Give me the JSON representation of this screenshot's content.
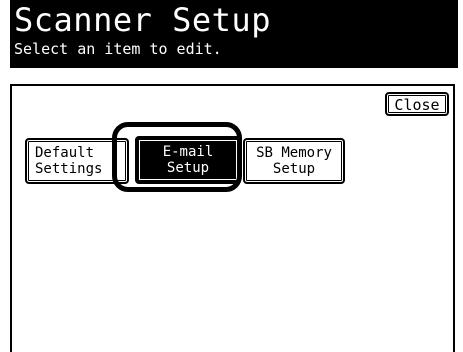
{
  "header": {
    "title": "Scanner Setup",
    "subtitle": "Select an item to edit."
  },
  "toolbar": {
    "close_label": "Close"
  },
  "menu": {
    "items": [
      {
        "line1": "Default",
        "line2": "Settings"
      },
      {
        "line1": "E-mail",
        "line2": "Setup",
        "selected": true
      },
      {
        "line1": "SB Memory",
        "line2": "Setup"
      }
    ]
  },
  "colors": {
    "background": "#ffffff",
    "ink": "#000000"
  }
}
